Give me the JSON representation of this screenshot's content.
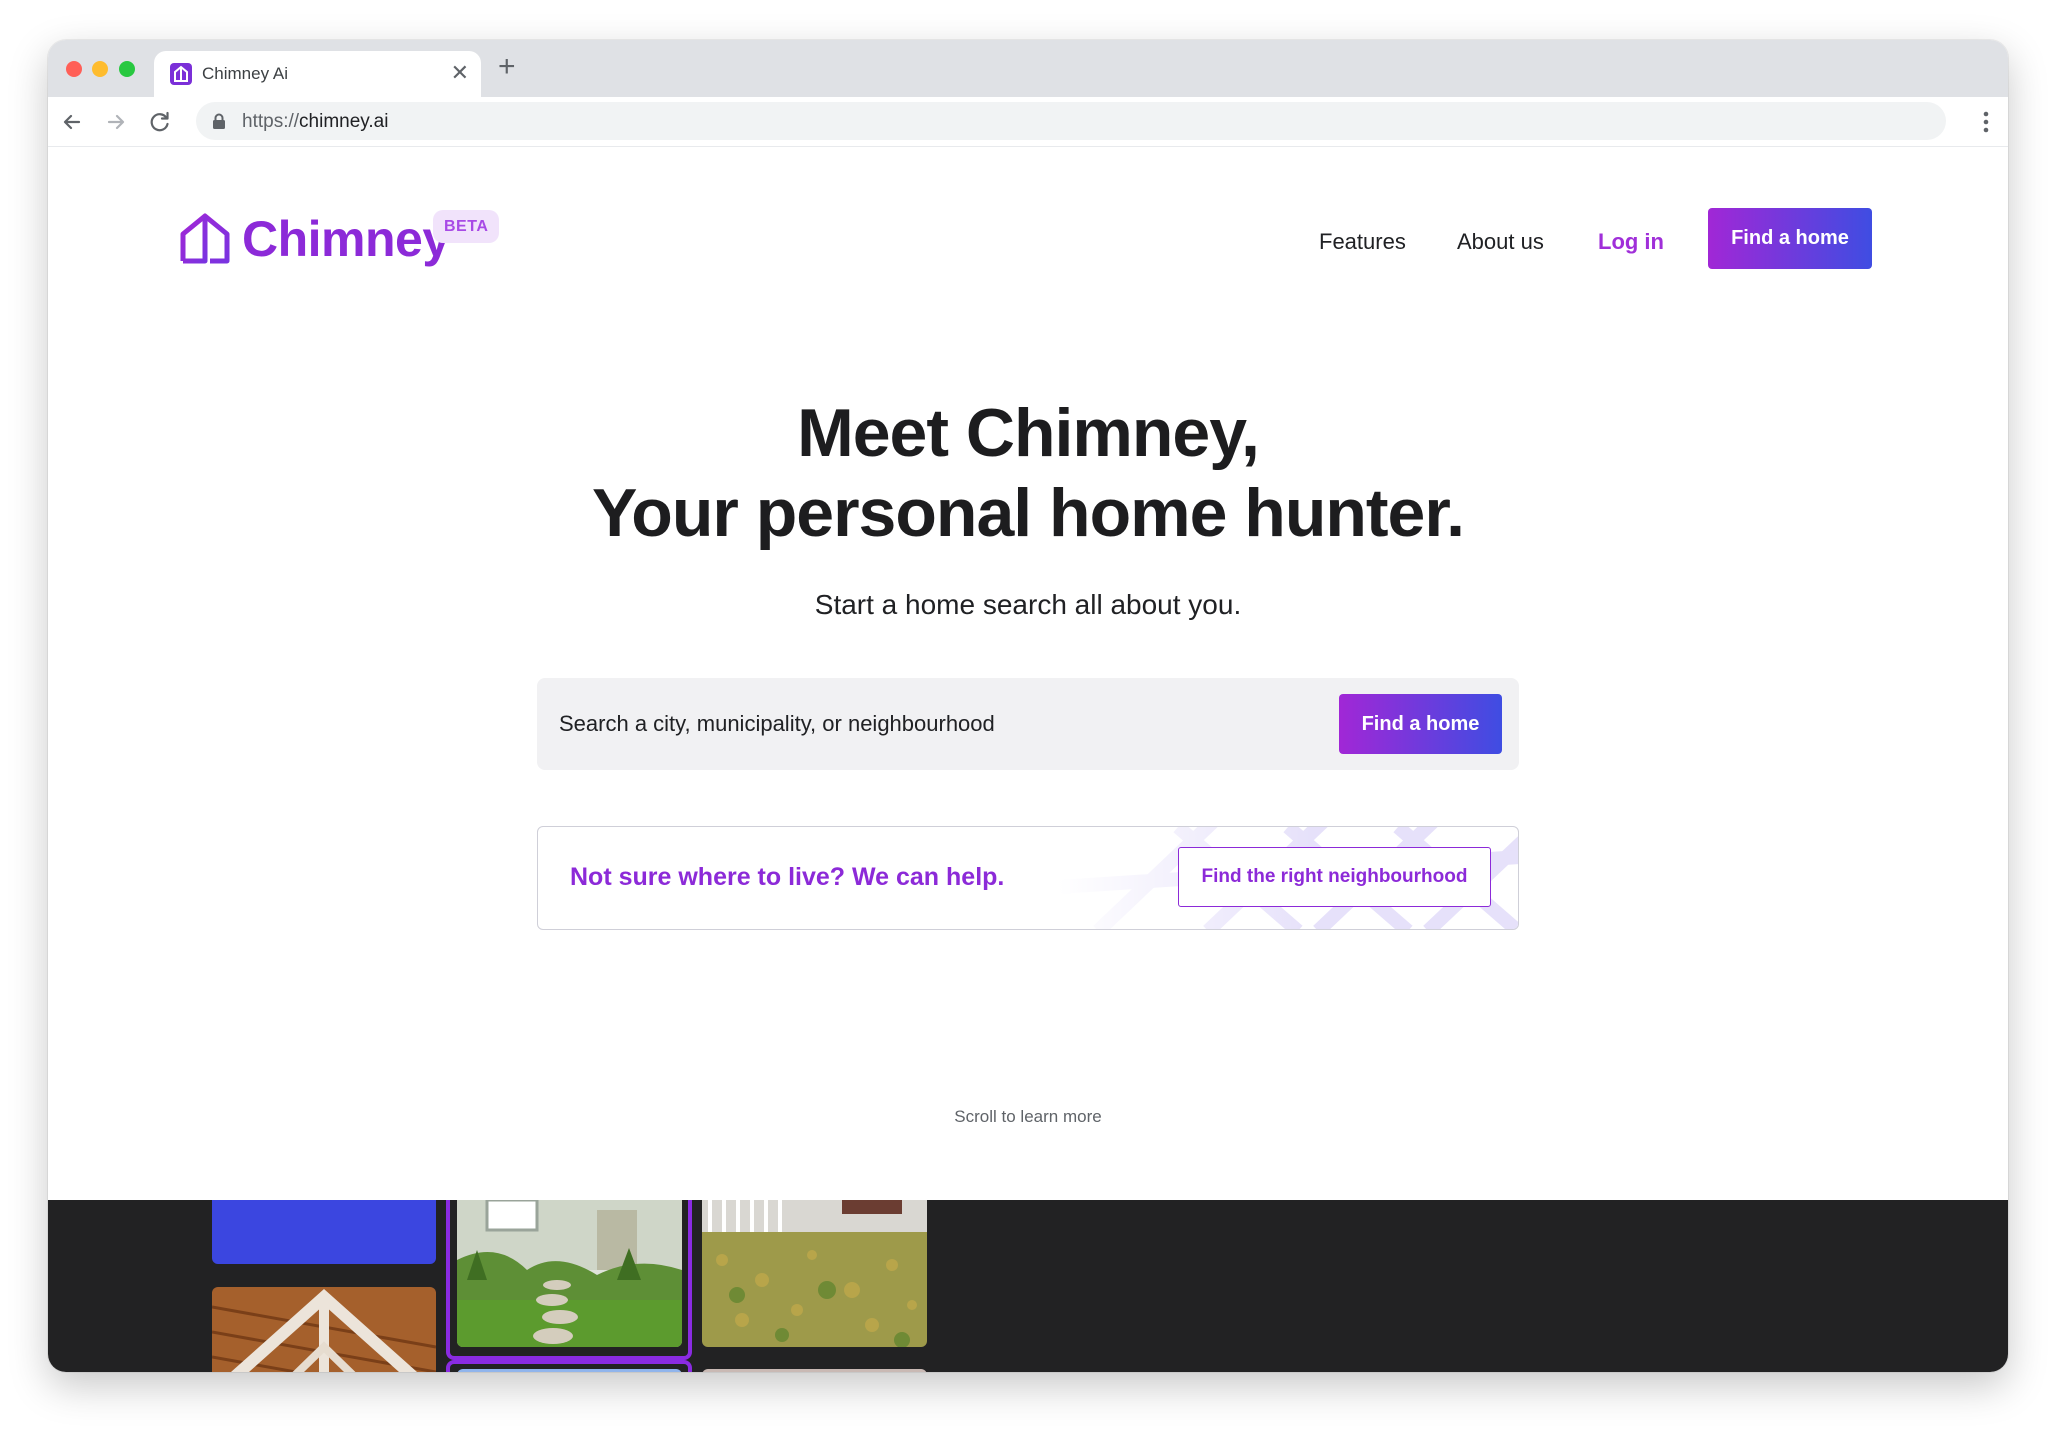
{
  "browser": {
    "tab_title": "Chimney Ai",
    "tab_close": "✕",
    "new_tab": "+",
    "url_scheme": "https://",
    "url_host": "chimney.ai"
  },
  "header": {
    "logo_text": "Chimney",
    "beta_badge": "BETA",
    "nav": {
      "features": "Features",
      "about": "About us",
      "login": "Log in",
      "cta": "Find a home"
    }
  },
  "hero": {
    "title_line1": "Meet Chimney,",
    "title_line2": "Your personal home hunter.",
    "subtitle": "Start a home search all about you."
  },
  "search": {
    "placeholder": "Search a city, municipality, or neighbourhood",
    "button": "Find a home"
  },
  "help_card": {
    "text": "Not sure where to live? We can help.",
    "button": "Find the right neighbourhood"
  },
  "scroll_hint": "Scroll to learn more",
  "colors": {
    "brand_purple": "#8c2ad8",
    "brand_blue": "#3f4de2",
    "dark_band": "#222223"
  },
  "icons": {
    "back": "arrow-left-icon",
    "forward": "arrow-right-icon",
    "reload": "reload-icon",
    "lock": "lock-icon",
    "menu": "vertical-dots-icon",
    "logo": "house-icon"
  }
}
